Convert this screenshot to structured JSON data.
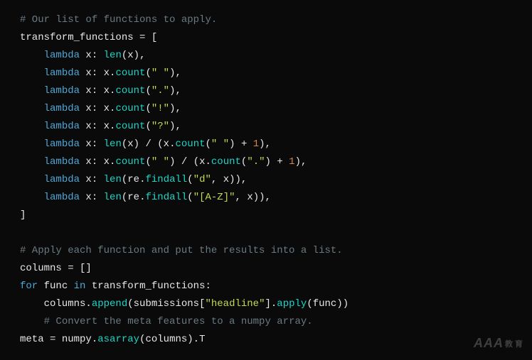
{
  "code": {
    "lines": [
      [
        {
          "cls": "tok-comment",
          "t": "# Our list of functions to apply."
        }
      ],
      [
        {
          "cls": "tok-ident",
          "t": "transform_functions"
        },
        {
          "cls": "tok-op",
          "t": " = "
        },
        {
          "cls": "tok-punct",
          "t": "["
        }
      ],
      [
        {
          "cls": "tok-punct",
          "t": "    "
        },
        {
          "cls": "tok-keyword",
          "t": "lambda"
        },
        {
          "cls": "tok-ident",
          "t": " x"
        },
        {
          "cls": "tok-punct",
          "t": ": "
        },
        {
          "cls": "tok-func",
          "t": "len"
        },
        {
          "cls": "tok-punct",
          "t": "(x),"
        }
      ],
      [
        {
          "cls": "tok-punct",
          "t": "    "
        },
        {
          "cls": "tok-keyword",
          "t": "lambda"
        },
        {
          "cls": "tok-ident",
          "t": " x"
        },
        {
          "cls": "tok-punct",
          "t": ": x."
        },
        {
          "cls": "tok-func",
          "t": "count"
        },
        {
          "cls": "tok-punct",
          "t": "("
        },
        {
          "cls": "tok-string",
          "t": "\" \""
        },
        {
          "cls": "tok-punct",
          "t": "),"
        }
      ],
      [
        {
          "cls": "tok-punct",
          "t": "    "
        },
        {
          "cls": "tok-keyword",
          "t": "lambda"
        },
        {
          "cls": "tok-ident",
          "t": " x"
        },
        {
          "cls": "tok-punct",
          "t": ": x."
        },
        {
          "cls": "tok-func",
          "t": "count"
        },
        {
          "cls": "tok-punct",
          "t": "("
        },
        {
          "cls": "tok-string",
          "t": "\".\""
        },
        {
          "cls": "tok-punct",
          "t": "),"
        }
      ],
      [
        {
          "cls": "tok-punct",
          "t": "    "
        },
        {
          "cls": "tok-keyword",
          "t": "lambda"
        },
        {
          "cls": "tok-ident",
          "t": " x"
        },
        {
          "cls": "tok-punct",
          "t": ": x."
        },
        {
          "cls": "tok-func",
          "t": "count"
        },
        {
          "cls": "tok-punct",
          "t": "("
        },
        {
          "cls": "tok-string",
          "t": "\"!\""
        },
        {
          "cls": "tok-punct",
          "t": "),"
        }
      ],
      [
        {
          "cls": "tok-punct",
          "t": "    "
        },
        {
          "cls": "tok-keyword",
          "t": "lambda"
        },
        {
          "cls": "tok-ident",
          "t": " x"
        },
        {
          "cls": "tok-punct",
          "t": ": x."
        },
        {
          "cls": "tok-func",
          "t": "count"
        },
        {
          "cls": "tok-punct",
          "t": "("
        },
        {
          "cls": "tok-string",
          "t": "\"?\""
        },
        {
          "cls": "tok-punct",
          "t": "),"
        }
      ],
      [
        {
          "cls": "tok-punct",
          "t": "    "
        },
        {
          "cls": "tok-keyword",
          "t": "lambda"
        },
        {
          "cls": "tok-ident",
          "t": " x"
        },
        {
          "cls": "tok-punct",
          "t": ": "
        },
        {
          "cls": "tok-func",
          "t": "len"
        },
        {
          "cls": "tok-punct",
          "t": "(x) / (x."
        },
        {
          "cls": "tok-func",
          "t": "count"
        },
        {
          "cls": "tok-punct",
          "t": "("
        },
        {
          "cls": "tok-string",
          "t": "\" \""
        },
        {
          "cls": "tok-punct",
          "t": ") + "
        },
        {
          "cls": "tok-number",
          "t": "1"
        },
        {
          "cls": "tok-punct",
          "t": "),"
        }
      ],
      [
        {
          "cls": "tok-punct",
          "t": "    "
        },
        {
          "cls": "tok-keyword",
          "t": "lambda"
        },
        {
          "cls": "tok-ident",
          "t": " x"
        },
        {
          "cls": "tok-punct",
          "t": ": x."
        },
        {
          "cls": "tok-func",
          "t": "count"
        },
        {
          "cls": "tok-punct",
          "t": "("
        },
        {
          "cls": "tok-string",
          "t": "\" \""
        },
        {
          "cls": "tok-punct",
          "t": ") / (x."
        },
        {
          "cls": "tok-func",
          "t": "count"
        },
        {
          "cls": "tok-punct",
          "t": "("
        },
        {
          "cls": "tok-string",
          "t": "\".\""
        },
        {
          "cls": "tok-punct",
          "t": ") + "
        },
        {
          "cls": "tok-number",
          "t": "1"
        },
        {
          "cls": "tok-punct",
          "t": "),"
        }
      ],
      [
        {
          "cls": "tok-punct",
          "t": "    "
        },
        {
          "cls": "tok-keyword",
          "t": "lambda"
        },
        {
          "cls": "tok-ident",
          "t": " x"
        },
        {
          "cls": "tok-punct",
          "t": ": "
        },
        {
          "cls": "tok-func",
          "t": "len"
        },
        {
          "cls": "tok-punct",
          "t": "(re."
        },
        {
          "cls": "tok-func",
          "t": "findall"
        },
        {
          "cls": "tok-punct",
          "t": "("
        },
        {
          "cls": "tok-string",
          "t": "\"d\""
        },
        {
          "cls": "tok-punct",
          "t": ", x)),"
        }
      ],
      [
        {
          "cls": "tok-punct",
          "t": "    "
        },
        {
          "cls": "tok-keyword",
          "t": "lambda"
        },
        {
          "cls": "tok-ident",
          "t": " x"
        },
        {
          "cls": "tok-punct",
          "t": ": "
        },
        {
          "cls": "tok-func",
          "t": "len"
        },
        {
          "cls": "tok-punct",
          "t": "(re."
        },
        {
          "cls": "tok-func",
          "t": "findall"
        },
        {
          "cls": "tok-punct",
          "t": "("
        },
        {
          "cls": "tok-string",
          "t": "\"[A-Z]\""
        },
        {
          "cls": "tok-punct",
          "t": ", x)),"
        }
      ],
      [
        {
          "cls": "tok-punct",
          "t": "]"
        }
      ],
      [
        {
          "cls": "tok-punct",
          "t": ""
        }
      ],
      [
        {
          "cls": "tok-comment",
          "t": "# Apply each function and put the results into a list."
        }
      ],
      [
        {
          "cls": "tok-ident",
          "t": "columns"
        },
        {
          "cls": "tok-op",
          "t": " = "
        },
        {
          "cls": "tok-punct",
          "t": "[]"
        }
      ],
      [
        {
          "cls": "tok-keyword",
          "t": "for"
        },
        {
          "cls": "tok-ident",
          "t": " func "
        },
        {
          "cls": "tok-keyword",
          "t": "in"
        },
        {
          "cls": "tok-ident",
          "t": " transform_functions"
        },
        {
          "cls": "tok-punct",
          "t": ":"
        }
      ],
      [
        {
          "cls": "tok-punct",
          "t": "    columns."
        },
        {
          "cls": "tok-func",
          "t": "append"
        },
        {
          "cls": "tok-punct",
          "t": "(submissions["
        },
        {
          "cls": "tok-string",
          "t": "\"headline\""
        },
        {
          "cls": "tok-punct",
          "t": "]."
        },
        {
          "cls": "tok-func",
          "t": "apply"
        },
        {
          "cls": "tok-punct",
          "t": "(func))"
        }
      ],
      [
        {
          "cls": "tok-punct",
          "t": "    "
        },
        {
          "cls": "tok-comment",
          "t": "# Convert the meta features to a numpy array."
        }
      ],
      [
        {
          "cls": "tok-ident",
          "t": "meta"
        },
        {
          "cls": "tok-op",
          "t": " = "
        },
        {
          "cls": "tok-ident",
          "t": "numpy."
        },
        {
          "cls": "tok-func",
          "t": "asarray"
        },
        {
          "cls": "tok-punct",
          "t": "(columns).T"
        }
      ]
    ]
  },
  "watermark": {
    "main": "AAA",
    "sub": "教育"
  }
}
